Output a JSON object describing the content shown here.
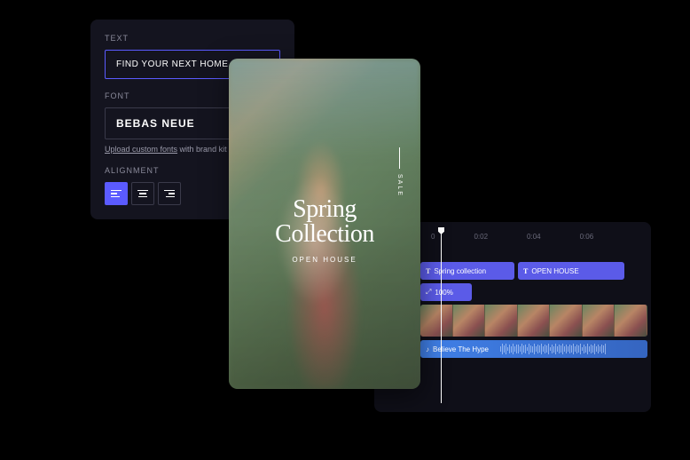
{
  "textPanel": {
    "textLabel": "TEXT",
    "textValue": "FIND YOUR NEXT HOME",
    "fontLabel": "FONT",
    "fontValue": "BEBAS NEUE",
    "uploadLink": "Upload custom fonts",
    "uploadTail": " with brand kit",
    "alignLabel": "ALIGNMENT"
  },
  "preview": {
    "titleLine1": "Spring",
    "titleLine2": "Collection",
    "subtitle": "OPEN HOUSE",
    "vertical": "SALE"
  },
  "timeline": {
    "ticks": [
      "0",
      "0:02",
      "0:04",
      "0:06"
    ],
    "zoomClip": "100%",
    "springClip": "Spring collection",
    "openClip": "OPEN HOUSE",
    "audioClip": "Believe The Hype"
  }
}
